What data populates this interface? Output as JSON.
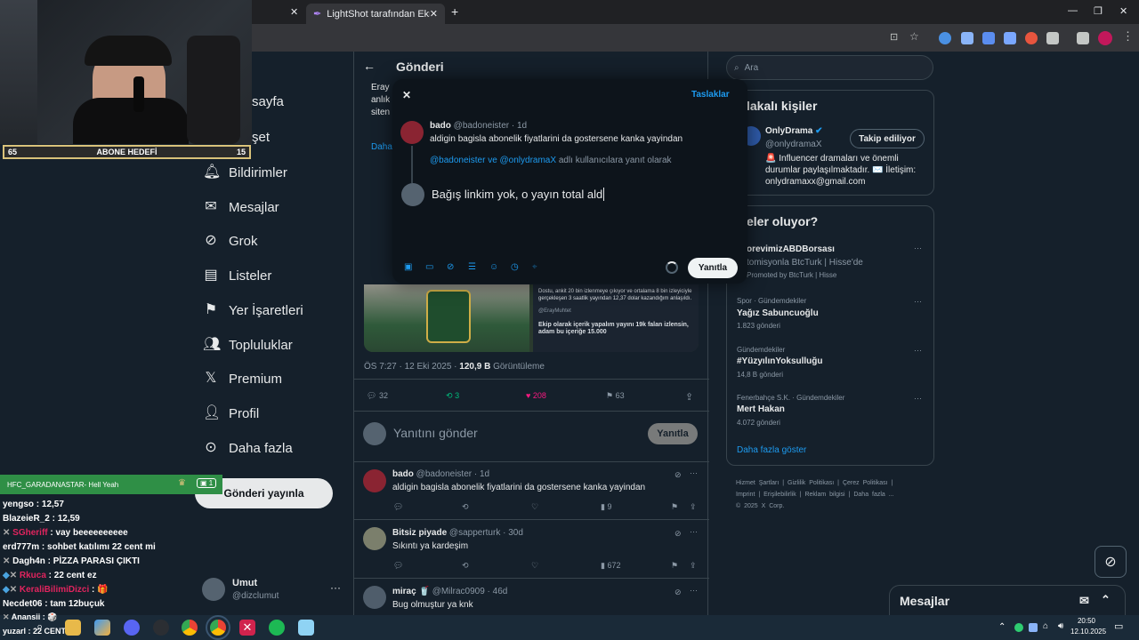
{
  "browser": {
    "tabs": [
      {
        "label": "LightShot tarafından Ekran Gör"
      }
    ],
    "new_tab": "+",
    "window_controls": [
      "—",
      "❐",
      "✕"
    ]
  },
  "sidebar": {
    "items": [
      {
        "label": "sayfa"
      },
      {
        "label": "şet"
      },
      {
        "label": "Bildirimler"
      },
      {
        "label": "Mesajlar"
      },
      {
        "label": "Grok"
      },
      {
        "label": "Listeler"
      },
      {
        "label": "Yer İşaretleri"
      },
      {
        "label": "Topluluklar"
      },
      {
        "label": "Premium"
      },
      {
        "label": "Profil"
      },
      {
        "label": "Daha fazla"
      }
    ],
    "post_button": "Gönderi yayınla",
    "account": {
      "name": "Umut",
      "handle": "@dizclumut"
    }
  },
  "center": {
    "header": "Gönderi",
    "tweet_text_fragments": [
      "Eray",
      "anlık",
      "siten",
      "Daha"
    ],
    "image_caption_1": "Dostu, ankit 20 bin izlenmeye çıkıyor ve ortalama 8 bin izleyiciyle gerçekleşen 3 saatlik yayından 12,37 dolar kazandığım anlaşıldı.",
    "image_handle": "@ErayMuhtet",
    "image_caption_2": "Ekip olarak içerik yapalım yayını 19k falan izlensin, adam bu içeriğe 15.000",
    "meta_time": "ÖS 7:27 · 12 Eki 2025 · ",
    "meta_views": "120,9 B",
    "meta_views_label": " Görüntüleme",
    "stats": {
      "replies": "32",
      "reposts": "3",
      "likes": "208",
      "bookmarks": "63"
    },
    "reply_placeholder": "Yanıtını gönder",
    "reply_button": "Yanıtla",
    "replies": [
      {
        "name": "bado",
        "handle": "@badoneister · 1d",
        "text": "aldigin bagisla abonelik fiyatlarini da gostersene kanka yayindan",
        "views": "9"
      },
      {
        "name": "Bitsiz piyade",
        "handle": "@sapperturk · 30d",
        "text": "Sıkıntı ya kardeşim",
        "views": "672"
      },
      {
        "name": "miraç 🥤",
        "handle": "@Milrac0909 · 46d",
        "text": "Bug olmuştur ya knk",
        "views": ""
      }
    ]
  },
  "modal": {
    "close": "✕",
    "drafts": "Taslaklar",
    "quoted": {
      "name": "bado",
      "handle": "@badoneister",
      "time": "· 1d",
      "text": "aldigin bagisla abonelik fiyatlarini da gostersene kanka yayindan"
    },
    "reply_to_users": "@badoneister ve @onlydramaX",
    "reply_to_suffix": " adlı kullanıcılara yanıt olarak",
    "compose_text": "Bağış linkim yok, o yayın total ald",
    "submit": "Yanıtla"
  },
  "right": {
    "search_placeholder": "Ara",
    "related_title": "lakalı kişiler",
    "related": {
      "name": "OnlyDrama",
      "handle": "@onlydramaX",
      "follow": "Takip ediliyor",
      "bio": "🚨 Influencer dramaları ve önemli durumlar paylaşılmaktadır. ✉️ İletişim: onlydramaxx@gmail.com"
    },
    "trends_title": "eler oluyor?",
    "trends": [
      {
        "cat": "",
        "title": "orevimizABDBorsası",
        "count": "tomisyonla BtcTurk | Hisse'de",
        "extra": "Promoted by BtcTurk | Hisse"
      },
      {
        "cat": "Spor · Gündemdekiler",
        "title": "Yağız Sabuncuoğlu",
        "count": "1.823 gönderi",
        "extra": ""
      },
      {
        "cat": "Gündemdekiler",
        "title": "#YüzyılınYoksulluğu",
        "count": "14,8 B gönderi",
        "extra": ""
      },
      {
        "cat": "Fenerbahçe S.K. · Gündemdekiler",
        "title": "Mert Hakan",
        "count": "4.072 gönderi",
        "extra": ""
      }
    ],
    "show_more": "Daha fazla göster",
    "footer": [
      "Hizmet Şartları",
      "|",
      "Gizlilik Politikası",
      "|",
      "Çerez Politikası",
      "|",
      "Imprint",
      "|",
      "Erişilebilirlik",
      "|",
      "Reklam bilgisi",
      "|",
      "Daha fazla ...",
      "© 2025 X Corp."
    ],
    "messages": "Mesajlar"
  },
  "stream": {
    "goal_left": "65",
    "goal_label": "ABONE HEDEFİ",
    "goal_right": "15",
    "chat_header_user": "HFC_GARADANASTAR",
    "chat_header_msg": " - Hell Yeah",
    "chat_header_count": "1",
    "chat": [
      {
        "user": "yengso",
        "msg": ": 12,57",
        "color": "#ffffff"
      },
      {
        "user": "BlazeieR_2",
        "msg": ": 12,59",
        "color": "#ffffff"
      },
      {
        "user": "SGheriff",
        "msg": ": vay beeeeeeeeee",
        "color": "#e0245e"
      },
      {
        "user": "erd777m",
        "msg": ": sohbet katılımı 22 cent mi",
        "color": "#ffffff"
      },
      {
        "user": "Dagh4n",
        "msg": ": PİZZA PARASI ÇIKTI",
        "color": "#ffffff"
      },
      {
        "user": "Rkuca",
        "msg": ": 22 cent ez",
        "color": "#e0245e"
      },
      {
        "user": "KeraliBilimiDizci",
        "msg": ": 🎁",
        "color": "#e0245e"
      },
      {
        "user": "Necdet06",
        "msg": ": tam 12buçuk",
        "color": "#ffffff"
      },
      {
        "user": "Anansii",
        "msg": ": 🎲",
        "color": "#ffffff"
      },
      {
        "user": "yuzarl",
        "msg": ": 22 CENT",
        "color": "#ffffff"
      }
    ]
  },
  "taskbar": {
    "time": "20:50",
    "date": "12.10.2025"
  }
}
